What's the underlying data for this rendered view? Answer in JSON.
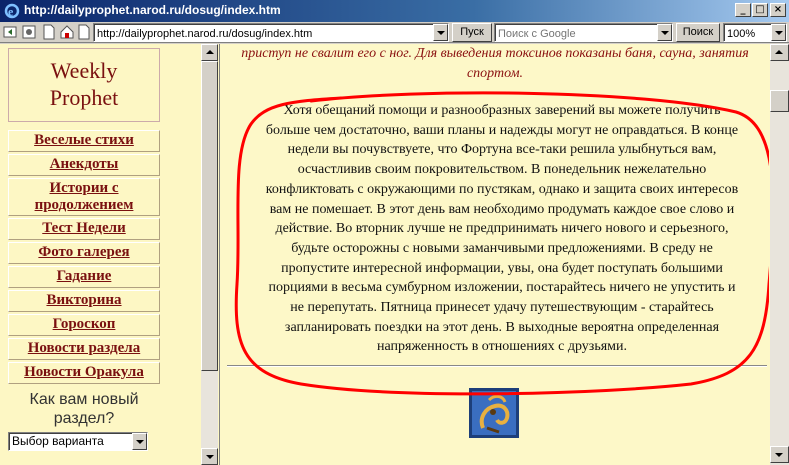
{
  "window": {
    "title": "http://dailyprophet.narod.ru/dosug/index.htm",
    "minimize_glyph": "_",
    "maximize_glyph": "□",
    "close_glyph": "×"
  },
  "toolbar": {
    "address_value": "http://dailyprophet.narod.ru/dosug/index.htm",
    "go_label": "Пуск",
    "search_placeholder": "Поиск с Google",
    "search_label": "Поиск",
    "zoom_value": "100%"
  },
  "sidebar": {
    "logo_line1": "Weekly",
    "logo_line2": "Prophet",
    "items": [
      {
        "label": "Веселые стихи"
      },
      {
        "label": "Анекдоты"
      },
      {
        "label_line1": "Истории с",
        "label_line2": "продолжением"
      },
      {
        "label": "Тест Недели"
      },
      {
        "label": "Фото галерея"
      },
      {
        "label": "Гадание"
      },
      {
        "label": "Викторина"
      },
      {
        "label": "Гороскоп"
      },
      {
        "label": "Новости раздела"
      },
      {
        "label": "Новости Оракула"
      }
    ],
    "poll_question_line1": "Как вам новый",
    "poll_question_line2": "раздел?",
    "poll_select_value": "Выбор варианта"
  },
  "main": {
    "intro_text": "приступ не свалит его с ног. Для выведения токсинов показаны баня, сауна, занятия спортом.",
    "article_lines": [
      "Хотя обещаний помощи и разнообразных заверений вы можете получить",
      "больше чем достаточно, ваши планы и надежды могут не оправдаться. В конце",
      "недели вы почувствуете, что Фортуна все-таки решила улыбнуться вам,",
      "осчастливив своим покровительством. В понедельник нежелательно",
      "конфликтовать с окружающими по пустякам, однако и защита своих интересов",
      "вам не помешает. В этот день вам необходимо продумать каждое свое слово и",
      "действие. Во вторник лучше не предпринимать ничего нового и серьезного,",
      "будьте осторожны с новыми заманчивыми предложениями. В среду не",
      "пропустите интересной информации, увы, она будет поступать большими",
      "порциями в весьма сумбурном изложении, постарайтесь ничего не упустить и",
      "не перепутать. Пятница принесет удачу путешествующим - старайтесь",
      "запланировать поездки на этот день. В выходные вероятна определенная",
      "напряженность в отношениях с друзьями."
    ]
  },
  "colors": {
    "page_bg": "#fdf8c8",
    "link_red": "#7a1010",
    "annotation_red": "#ff0000"
  },
  "icons": {
    "browser": "ie-icon",
    "horoscope": "capricorn-icon"
  }
}
